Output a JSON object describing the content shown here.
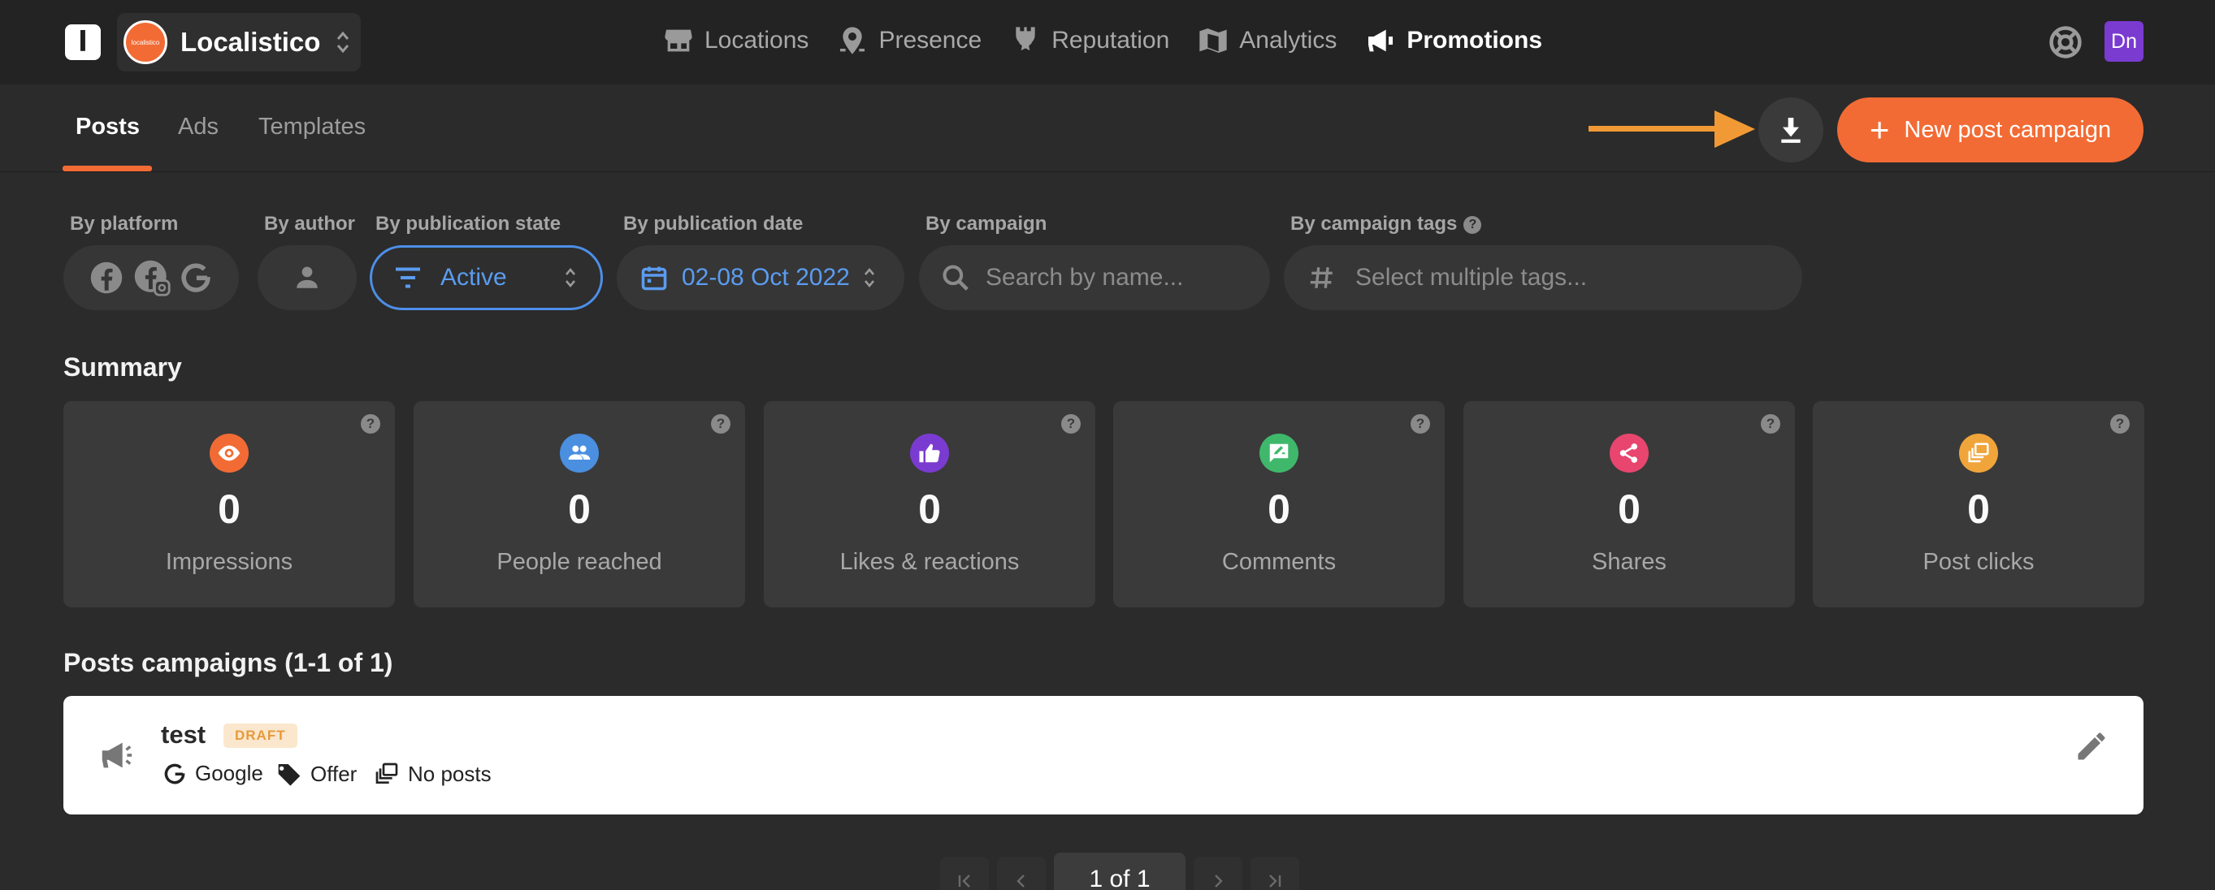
{
  "app": {
    "org_name": "Localistico",
    "org_avatar_text": "localistico",
    "logo_letter": "l",
    "user_initials": "Dn"
  },
  "nav": {
    "items": [
      {
        "label": "Locations",
        "icon": "store-icon"
      },
      {
        "label": "Presence",
        "icon": "location-pin-icon"
      },
      {
        "label": "Reputation",
        "icon": "award-star-icon"
      },
      {
        "label": "Analytics",
        "icon": "map-chart-icon"
      },
      {
        "label": "Promotions",
        "icon": "megaphone-icon",
        "active": true
      }
    ]
  },
  "subtabs": {
    "posts": "Posts",
    "ads": "Ads",
    "templates": "Templates"
  },
  "actions": {
    "new_campaign": "New post campaign"
  },
  "filters": {
    "platform_label": "By platform",
    "author_label": "By author",
    "state_label": "By publication state",
    "state_value": "Active",
    "date_label": "By publication date",
    "date_value": "02-08 Oct 2022",
    "campaign_label": "By campaign",
    "campaign_placeholder": "Search by name...",
    "tags_label": "By campaign tags",
    "tags_placeholder": "Select multiple tags..."
  },
  "summary": {
    "title": "Summary",
    "cards": [
      {
        "value": "0",
        "label": "Impressions",
        "color": "#f26b35",
        "icon": "eye-icon"
      },
      {
        "value": "0",
        "label": "People reached",
        "color": "#4a8fe0",
        "icon": "people-icon"
      },
      {
        "value": "0",
        "label": "Likes & reactions",
        "color": "#7a3bd1",
        "icon": "thumbs-up-icon"
      },
      {
        "value": "0",
        "label": "Comments",
        "color": "#3fb86b",
        "icon": "comment-icon"
      },
      {
        "value": "0",
        "label": "Shares",
        "color": "#e8466f",
        "icon": "share-icon"
      },
      {
        "value": "0",
        "label": "Post clicks",
        "color": "#f0a53a",
        "icon": "clicks-icon"
      }
    ]
  },
  "campaigns": {
    "title": "Posts campaigns (1-1 of 1)",
    "items": [
      {
        "name": "test",
        "status": "DRAFT",
        "platform": "Google",
        "type": "Offer",
        "posts": "No posts"
      }
    ]
  },
  "pagination": {
    "page": "1 of 1"
  },
  "colors": {
    "accent": "#f26b35",
    "link_blue": "#5b9cf0",
    "arrow": "#f19a35"
  }
}
